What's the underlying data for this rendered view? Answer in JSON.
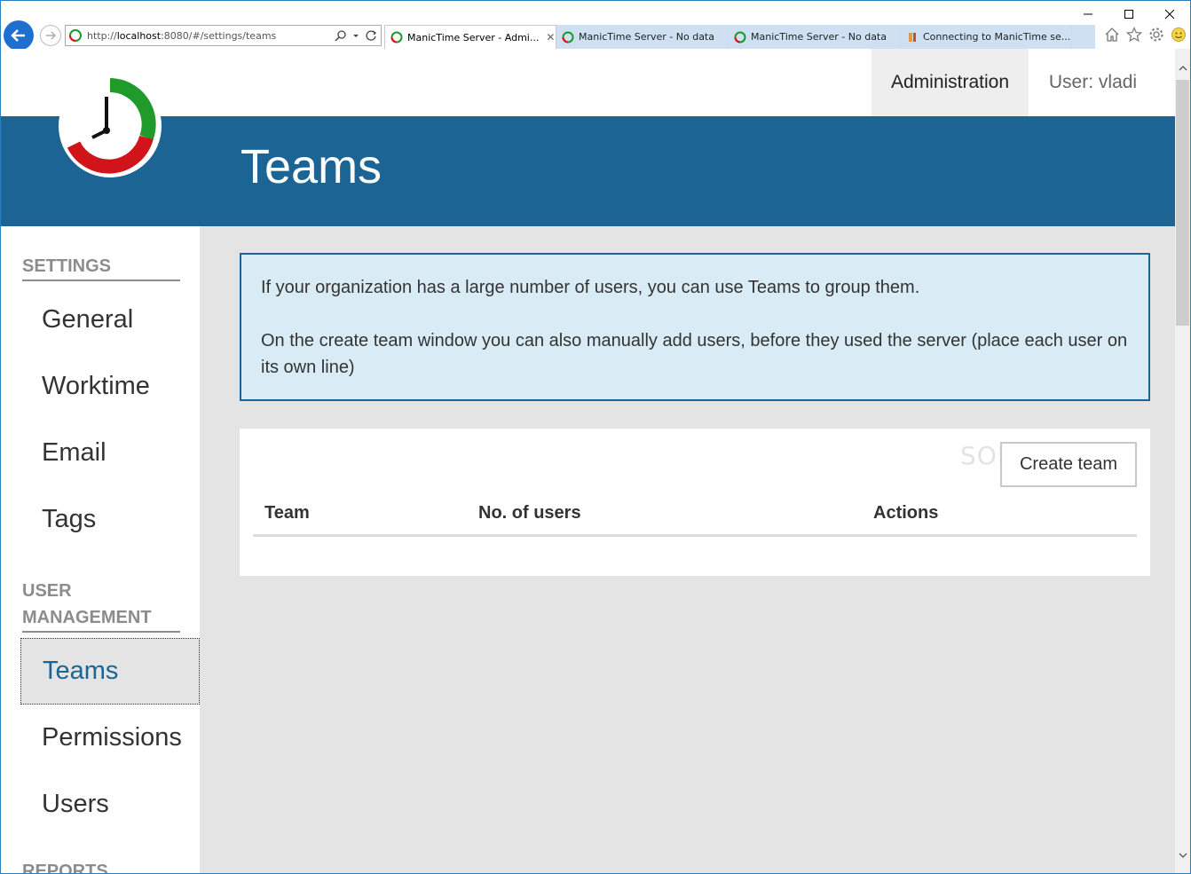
{
  "browser": {
    "url_prefix": "http://",
    "url_host": "localhost",
    "url_rest": ":8080/#/settings/teams",
    "tabs": [
      {
        "title": "ManicTime Server - Admi...",
        "active": true
      },
      {
        "title": "ManicTime Server - No data",
        "active": false
      },
      {
        "title": "ManicTime Server - No data",
        "active": false
      },
      {
        "title": "Connecting to ManicTime se...",
        "active": false
      }
    ]
  },
  "nav": {
    "administration": "Administration",
    "user": "User: vladi"
  },
  "banner": {
    "title": "Teams"
  },
  "sidebar": {
    "settings_heading": "SETTINGS",
    "settings_items": [
      "General",
      "Worktime",
      "Email",
      "Tags"
    ],
    "user_mgmt_heading_line1": "USER",
    "user_mgmt_heading_line2": "MANAGEMENT",
    "user_mgmt_items": [
      "Teams",
      "Permissions",
      "Users"
    ],
    "reports_heading": "REPORTS"
  },
  "info": {
    "line1": "If your organization has a large number of users, you can use Teams to group them.",
    "line2": "On the create team window you can also manually add users, before they used the server (place each user on its own line)"
  },
  "teams_table": {
    "create_button": "Create team",
    "columns": [
      "Team",
      "No. of users",
      "Actions"
    ],
    "rows": []
  },
  "watermark": "SOFTPEDIA",
  "colors": {
    "banner": "#1b6493",
    "active_link": "#1b6493",
    "info_bg": "#d9ecf5",
    "content_bg": "#e5e4e4"
  }
}
